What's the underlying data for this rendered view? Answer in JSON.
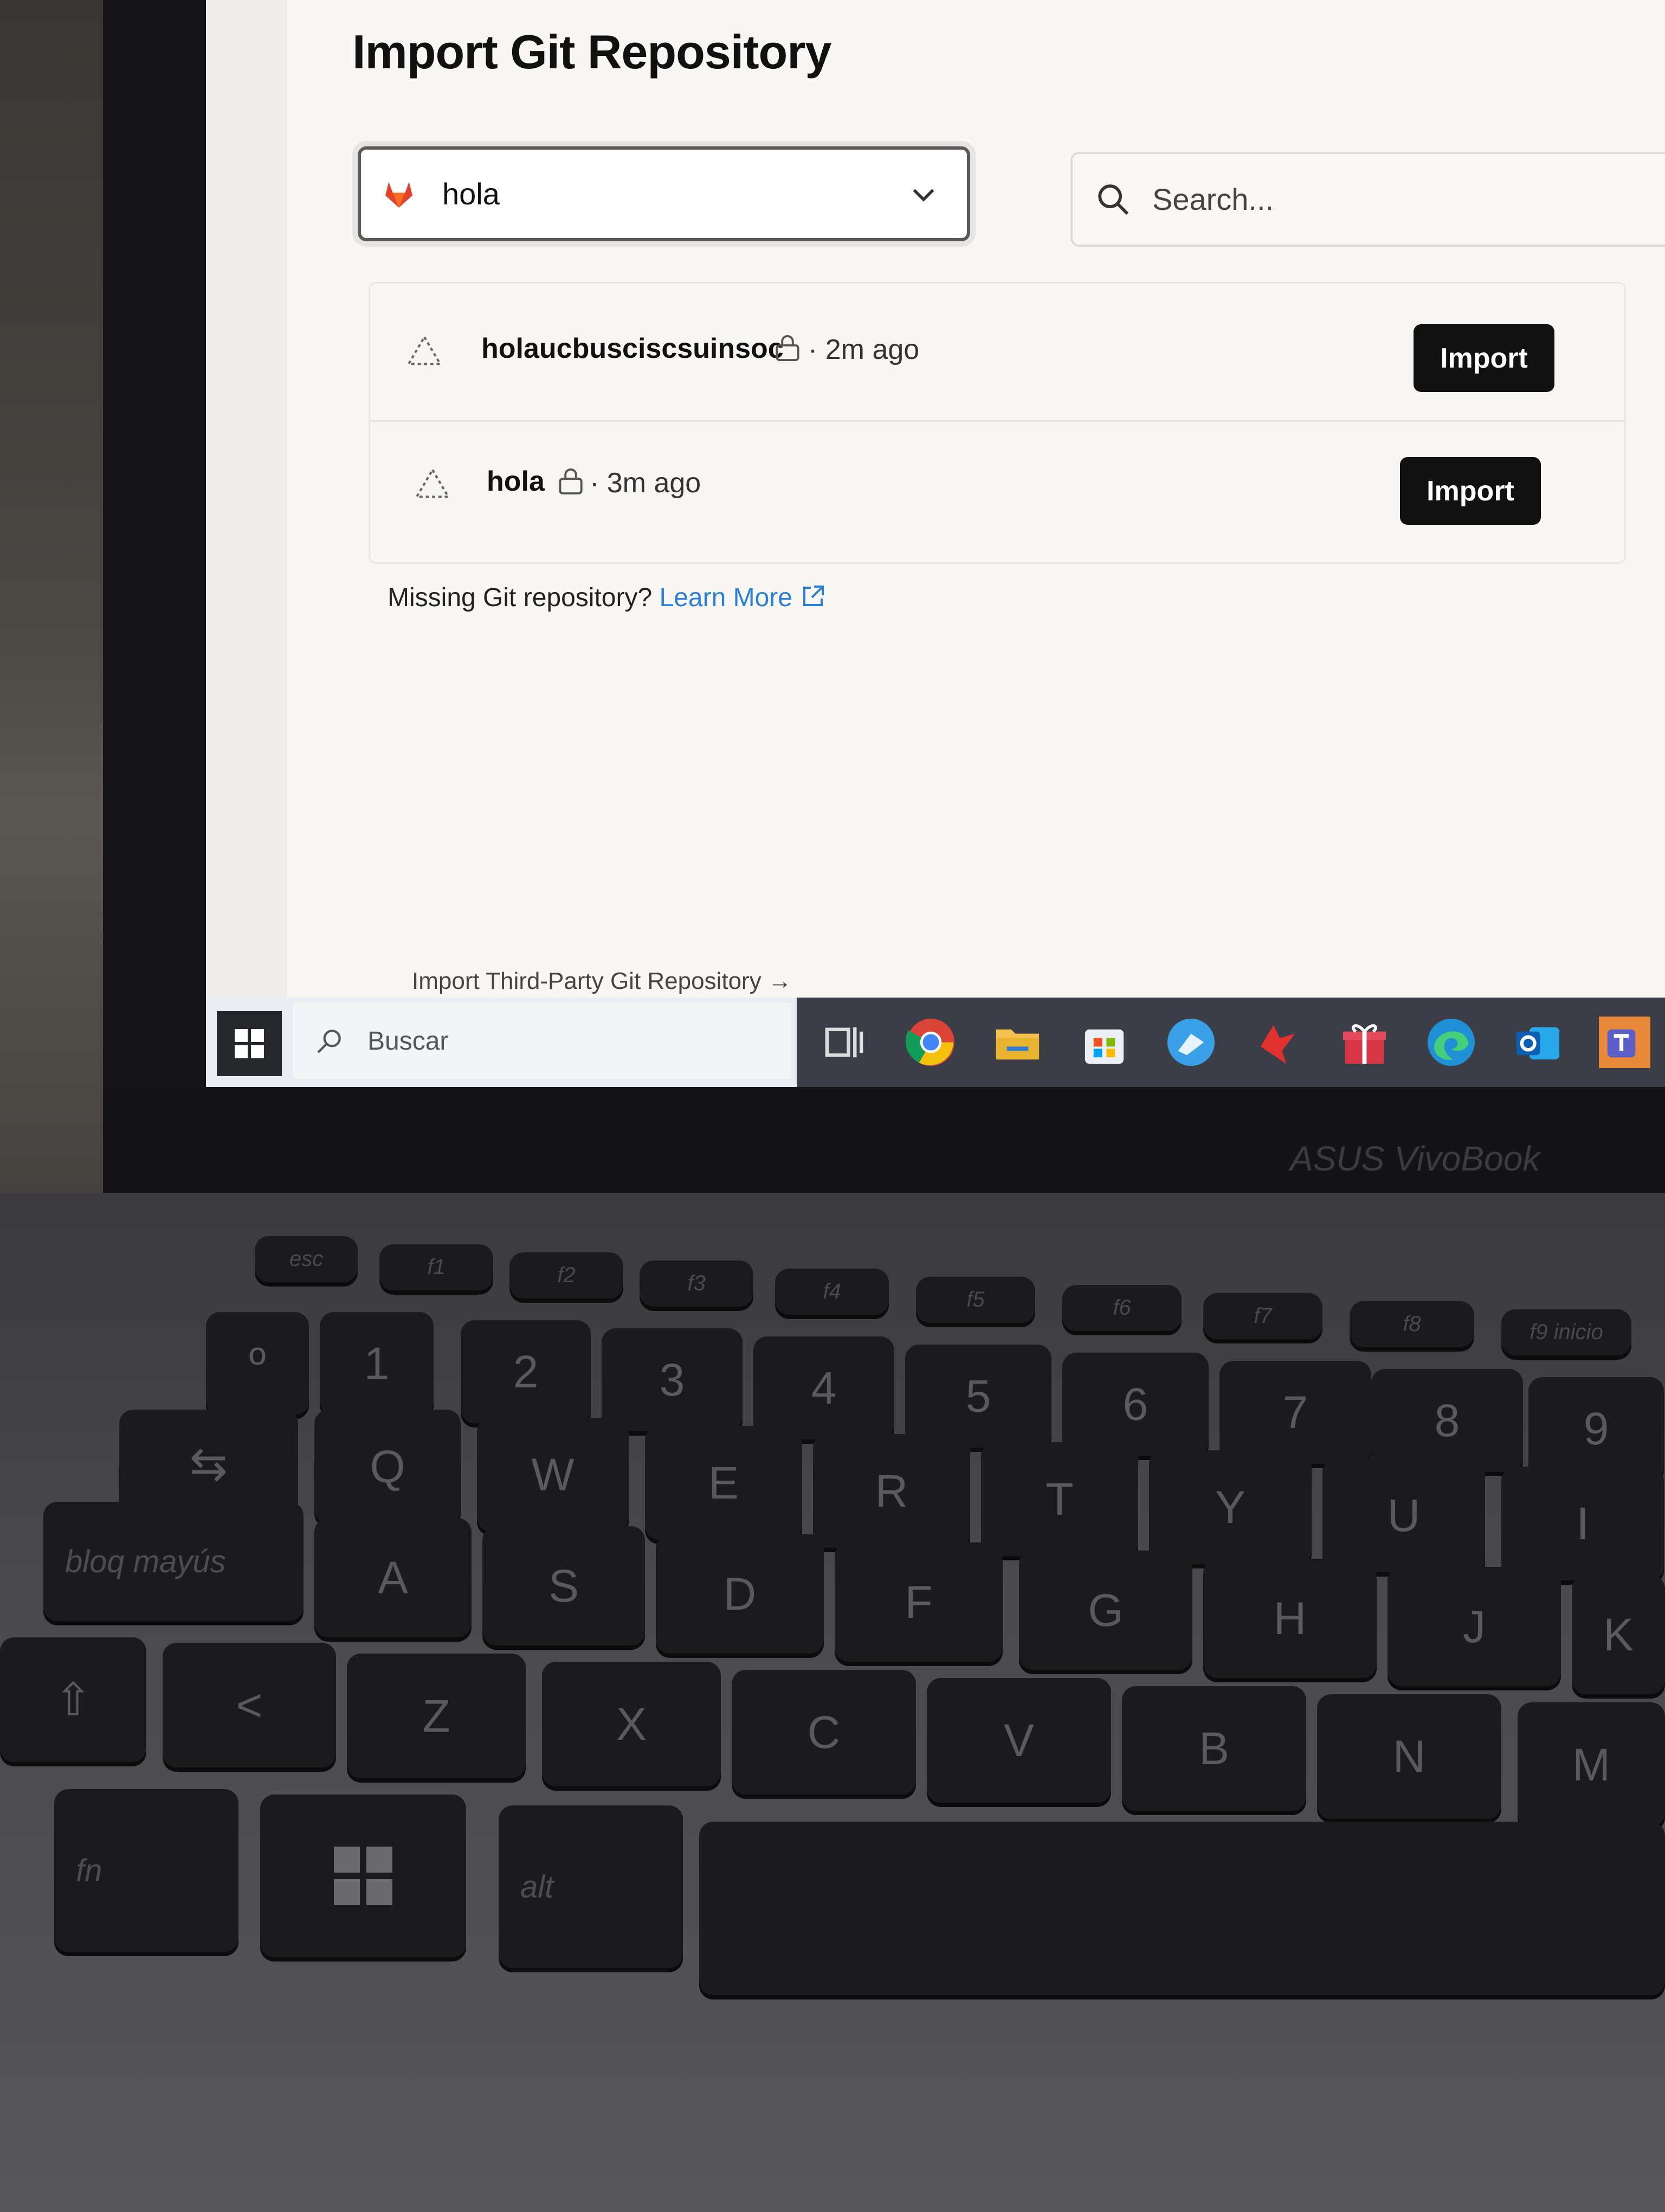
{
  "page": {
    "title": "Import Git Repository",
    "source_select": {
      "value": "hola",
      "icon": "gitlab-icon"
    },
    "search": {
      "placeholder": "Search..."
    },
    "repositories": [
      {
        "name": "holaucbusciscsuinsoc",
        "visibility": "private",
        "time": "· 2m ago",
        "import_label": "Import"
      },
      {
        "name": "hola",
        "visibility": "private",
        "time": "· 3m ago",
        "import_label": "Import"
      }
    ],
    "missing_text": "Missing Git repository?",
    "learn_more_label": "Learn More",
    "third_party_label": "Import Third-Party Git Repository →"
  },
  "taskbar": {
    "search_placeholder": "Buscar",
    "apps": [
      "task-view-icon",
      "chrome-icon",
      "file-explorer-icon",
      "microsoft-store-icon",
      "app-icon",
      "game-icon",
      "gift-icon",
      "edge-icon",
      "outlook-icon",
      "teams-icon"
    ]
  },
  "device": {
    "brand": "ASUS VivoBook",
    "keyboard": {
      "function_row": [
        "esc",
        "f1",
        "f2",
        "f3",
        "f4",
        "f5",
        "f6",
        "f7",
        "f8",
        "f9 inicio"
      ],
      "number_row": [
        "º",
        "1",
        "2",
        "3",
        "4",
        "5",
        "6",
        "7",
        "8",
        "9"
      ],
      "top_row": [
        "Q",
        "W",
        "E",
        "R",
        "T",
        "Y",
        "U",
        "I"
      ],
      "home_row": [
        "bloq mayús",
        "A",
        "S",
        "D",
        "F",
        "G",
        "H",
        "J",
        "K"
      ],
      "bottom_row": [
        "<",
        "Z",
        "X",
        "C",
        "V",
        "B",
        "N",
        "M"
      ],
      "space_row": [
        "fn",
        "alt"
      ]
    }
  },
  "colors": {
    "accent_link": "#2b7fd6",
    "button_bg": "#111111",
    "gitlab": "#e24329"
  }
}
